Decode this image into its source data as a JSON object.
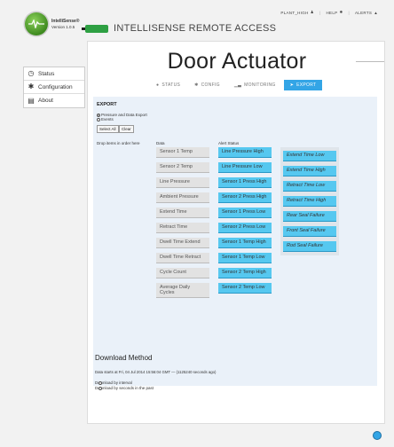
{
  "top_links": [
    {
      "label": "PLANT_HIGH",
      "icon": "person-icon"
    },
    {
      "label": "HELP",
      "icon": "compass-icon"
    },
    {
      "label": "ALERTS",
      "icon": "bell-icon"
    }
  ],
  "logo": {
    "name": "IntelliSense®",
    "version": "Version 1.0.5"
  },
  "brand": "INTELLISENSE REMOTE ACCESS",
  "sidebar": [
    {
      "label": "Status",
      "icon": "clock-icon"
    },
    {
      "label": "Configuration",
      "icon": "gear-icon"
    },
    {
      "label": "About",
      "icon": "document-icon"
    }
  ],
  "page_title": "Door Actuator",
  "tabs": [
    {
      "label": "STATUS",
      "icon": "dot-icon",
      "active": false
    },
    {
      "label": "CONFIG",
      "icon": "gear-icon",
      "active": false
    },
    {
      "label": "MONITORING",
      "icon": "chart-icon",
      "active": false
    },
    {
      "label": "EXPORT",
      "icon": "export-icon",
      "active": true
    }
  ],
  "export": {
    "title": "EXPORT",
    "option_pressure": "Pressure and Data Export",
    "option_events": "Events",
    "select_all": "Select All",
    "clear": "Clear",
    "drop_label": "Drop items in order here",
    "data_label": "Data",
    "alert_label": "Alert Status",
    "data_items": [
      "Sensor 1 Temp",
      "Sensor 2 Temp",
      "Line Pressure",
      "Ambient Pressure",
      "Extend Time",
      "Retract Time",
      "Dwell Time Extend",
      "Dwell Time Retract",
      "Cycle Count",
      "Average Daily Cycles"
    ],
    "alert_items": [
      "Line Pressure High",
      "Line Pressure Low",
      "Sensor 1 Press High",
      "Sensor 2 Press High",
      "Sensor 1 Press Low",
      "Sensor 2 Press Low",
      "Sensor 1 Temp High",
      "Sensor 1 Temp Low",
      "Sensor 2 Temp High",
      "Sensor 2 Temp Low"
    ],
    "extra_items": [
      "Extend Time Low",
      "Extend Time High",
      "Retract Time Low",
      "Retract Time High",
      "Rear Seal Failure",
      "Front Seal Failure",
      "Rod Seal Failure"
    ]
  },
  "download": {
    "title": "Download Method",
    "info": "Data starts at Fri, 04 Jul 2014 15:56:04 GMT — (1125240 seconds ago)",
    "by_interval": "Download by interval",
    "by_seconds": "Download by seconds in the past"
  },
  "colors": {
    "accent": "#33a5e6",
    "brand_green": "#2ea043",
    "chip_gray": "#e2e2e2",
    "chip_blue": "#56c8f0"
  }
}
